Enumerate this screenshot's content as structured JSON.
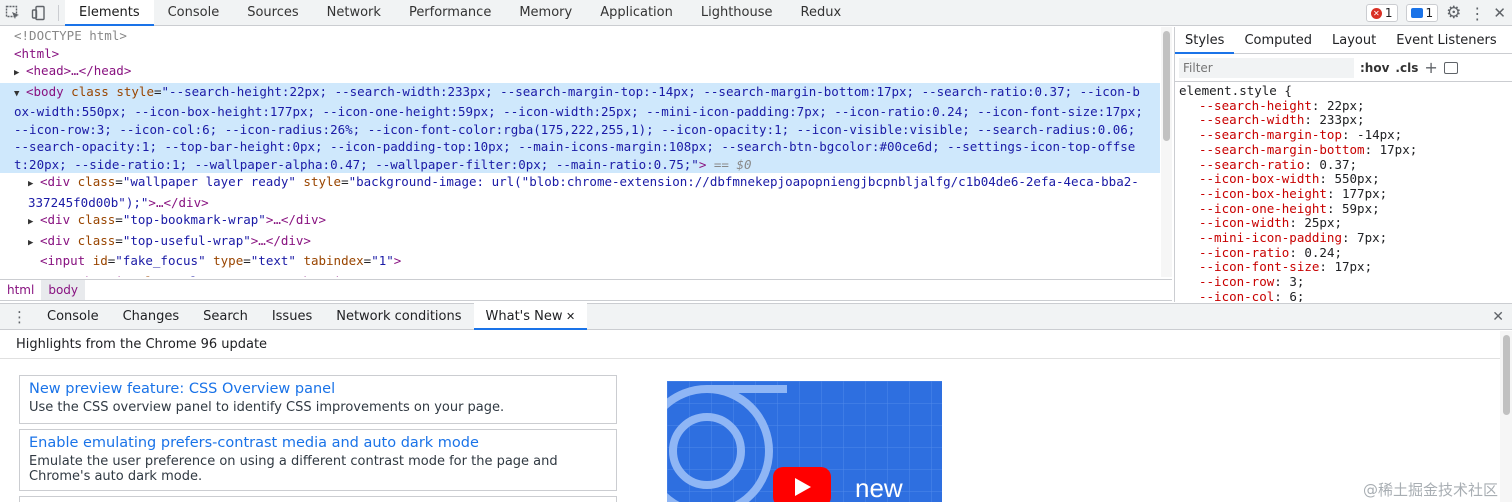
{
  "toolbar": {
    "tabs": [
      "Elements",
      "Console",
      "Sources",
      "Network",
      "Performance",
      "Memory",
      "Application",
      "Lighthouse",
      "Redux"
    ],
    "active_tab": "Elements",
    "error_count": "1",
    "message_count": "1"
  },
  "elements": {
    "doctype": "<!DOCTYPE html>",
    "html_open": "<html>",
    "head_collapsed": "<head>…</head>",
    "body_tag": "body",
    "body_attr_class": "class",
    "body_attr_style": "style",
    "body_style_lines": [
      "\"--search-height:22px; --search-width:233px; --search-margin-top:-14px; --search-margin-bottom:17px; --search-ratio:0.37; --icon-b",
      "ox-width:550px; --icon-box-height:177px; --icon-one-height:59px; --icon-width:25px; --mini-icon-padding:7px; --icon-ratio:0.24; --icon-font-size:17px;",
      "--icon-row:3; --icon-col:6; --icon-radius:26%; --icon-font-color:rgba(175,222,255,1); --icon-opacity:1; --icon-visible:visible; --search-radius:0.06;",
      "--search-opacity:1; --top-bar-height:0px; --icon-padding-top:10px; --main-icons-margin:108px; --search-btn-bgcolor:#00ce6d; --settings-icon-top-offse",
      "t:20px; --side-ratio:1; --wallpaper-alpha:0.47; --wallpaper-filter:0px; --main-ratio:0.75;\""
    ],
    "body_suffix": "== $0",
    "children": [
      {
        "text1": "<div ",
        "attr1": "class",
        "val1": "\"wallpaper layer ready\"",
        "attr2": " style",
        "val2": "\"background-image: url(\"blob:chrome-extension://dbfmnekepjoapopniengjbcpnbljalfg/c1b04de6-2efa-4eca-bba2-",
        "cont": "337245f0d00b\");\"",
        "end": ">…</div>"
      },
      {
        "text1": "<div ",
        "attr1": "class",
        "val1": "\"top-bookmark-wrap\"",
        "end": ">…</div>"
      },
      {
        "text1": "<div ",
        "attr1": "class",
        "val1": "\"top-useful-wrap\"",
        "end": ">…</div>"
      },
      {
        "text1": "<input ",
        "attr1": "id",
        "val1": "\"fake_focus\"",
        "attr2": " type",
        "val2": "\"text\"",
        "attr3": " tabindex",
        "val3": "\"1\"",
        "end": ">"
      },
      {
        "text1": "<newtab-main ",
        "attr1": "class",
        "val1": "\"layer\"",
        "end": ">…</newtab-main>"
      }
    ]
  },
  "breadcrumbs": [
    "html",
    "body"
  ],
  "styles_panel": {
    "tabs": [
      "Styles",
      "Computed",
      "Layout",
      "Event Listeners"
    ],
    "more": "»",
    "filter_placeholder": "Filter",
    "hov": ":hov",
    "cls": ".cls",
    "selector": "element.style {",
    "props": [
      [
        "--search-height",
        "22px;"
      ],
      [
        "--search-width",
        "233px;"
      ],
      [
        "--search-margin-top",
        "-14px;"
      ],
      [
        "--search-margin-bottom",
        "17px;"
      ],
      [
        "--search-ratio",
        "0.37;"
      ],
      [
        "--icon-box-width",
        "550px;"
      ],
      [
        "--icon-box-height",
        "177px;"
      ],
      [
        "--icon-one-height",
        "59px;"
      ],
      [
        "--icon-width",
        "25px;"
      ],
      [
        "--mini-icon-padding",
        "7px;"
      ],
      [
        "--icon-ratio",
        "0.24;"
      ],
      [
        "--icon-font-size",
        "17px;"
      ],
      [
        "--icon-row",
        "3;"
      ],
      [
        "--icon-col",
        "6;"
      ]
    ]
  },
  "drawer": {
    "tabs": [
      "Console",
      "Changes",
      "Search",
      "Issues",
      "Network conditions",
      "What's New"
    ],
    "active_tab": "What's New",
    "heading": "Highlights from the Chrome 96 update",
    "cards": [
      {
        "title": "New preview feature: CSS Overview panel",
        "desc": "Use the CSS overview panel to identify CSS improvements on your page."
      },
      {
        "title": "Enable emulating prefers-contrast media and auto dark mode",
        "desc": "Emulate the user preference on using a different contrast mode for the page and Chrome's auto dark mode."
      }
    ],
    "promo_text": "new"
  },
  "watermark": "@稀土掘金技术社区"
}
